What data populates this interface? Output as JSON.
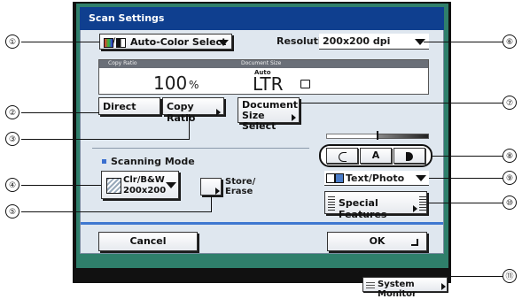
{
  "window": {
    "title": "Scan Settings"
  },
  "color_select": {
    "label": "Auto-Color Select"
  },
  "resolution": {
    "label": "Resolution:",
    "value": "200x200 dpi"
  },
  "display": {
    "copy_ratio_label": "Copy Ratio",
    "copy_ratio_value": "100",
    "copy_ratio_unit": "%",
    "document_size_label": "Document Size",
    "document_size_auto": "Auto",
    "document_size_value": "LTR"
  },
  "buttons": {
    "direct": "Direct",
    "copy_ratio": "Copy Ratio",
    "document_size_line1": "Document",
    "document_size_line2": "Size Select",
    "cancel": "Cancel",
    "ok": "OK",
    "system_monitor": "System Monitor",
    "special_features": "Special Features",
    "store_erase_line1": "Store/",
    "store_erase_line2": "Erase"
  },
  "scanning_mode": {
    "label": "Scanning Mode",
    "value_line1": "Clr/B&W",
    "value_line2": "200x200"
  },
  "density": {
    "manual": "A"
  },
  "original_type": {
    "value": "Text/Photo"
  },
  "callouts": [
    "①",
    "②",
    "③",
    "④",
    "⑤",
    "⑥",
    "⑦",
    "⑧",
    "⑨",
    "⑩",
    "⑪"
  ]
}
